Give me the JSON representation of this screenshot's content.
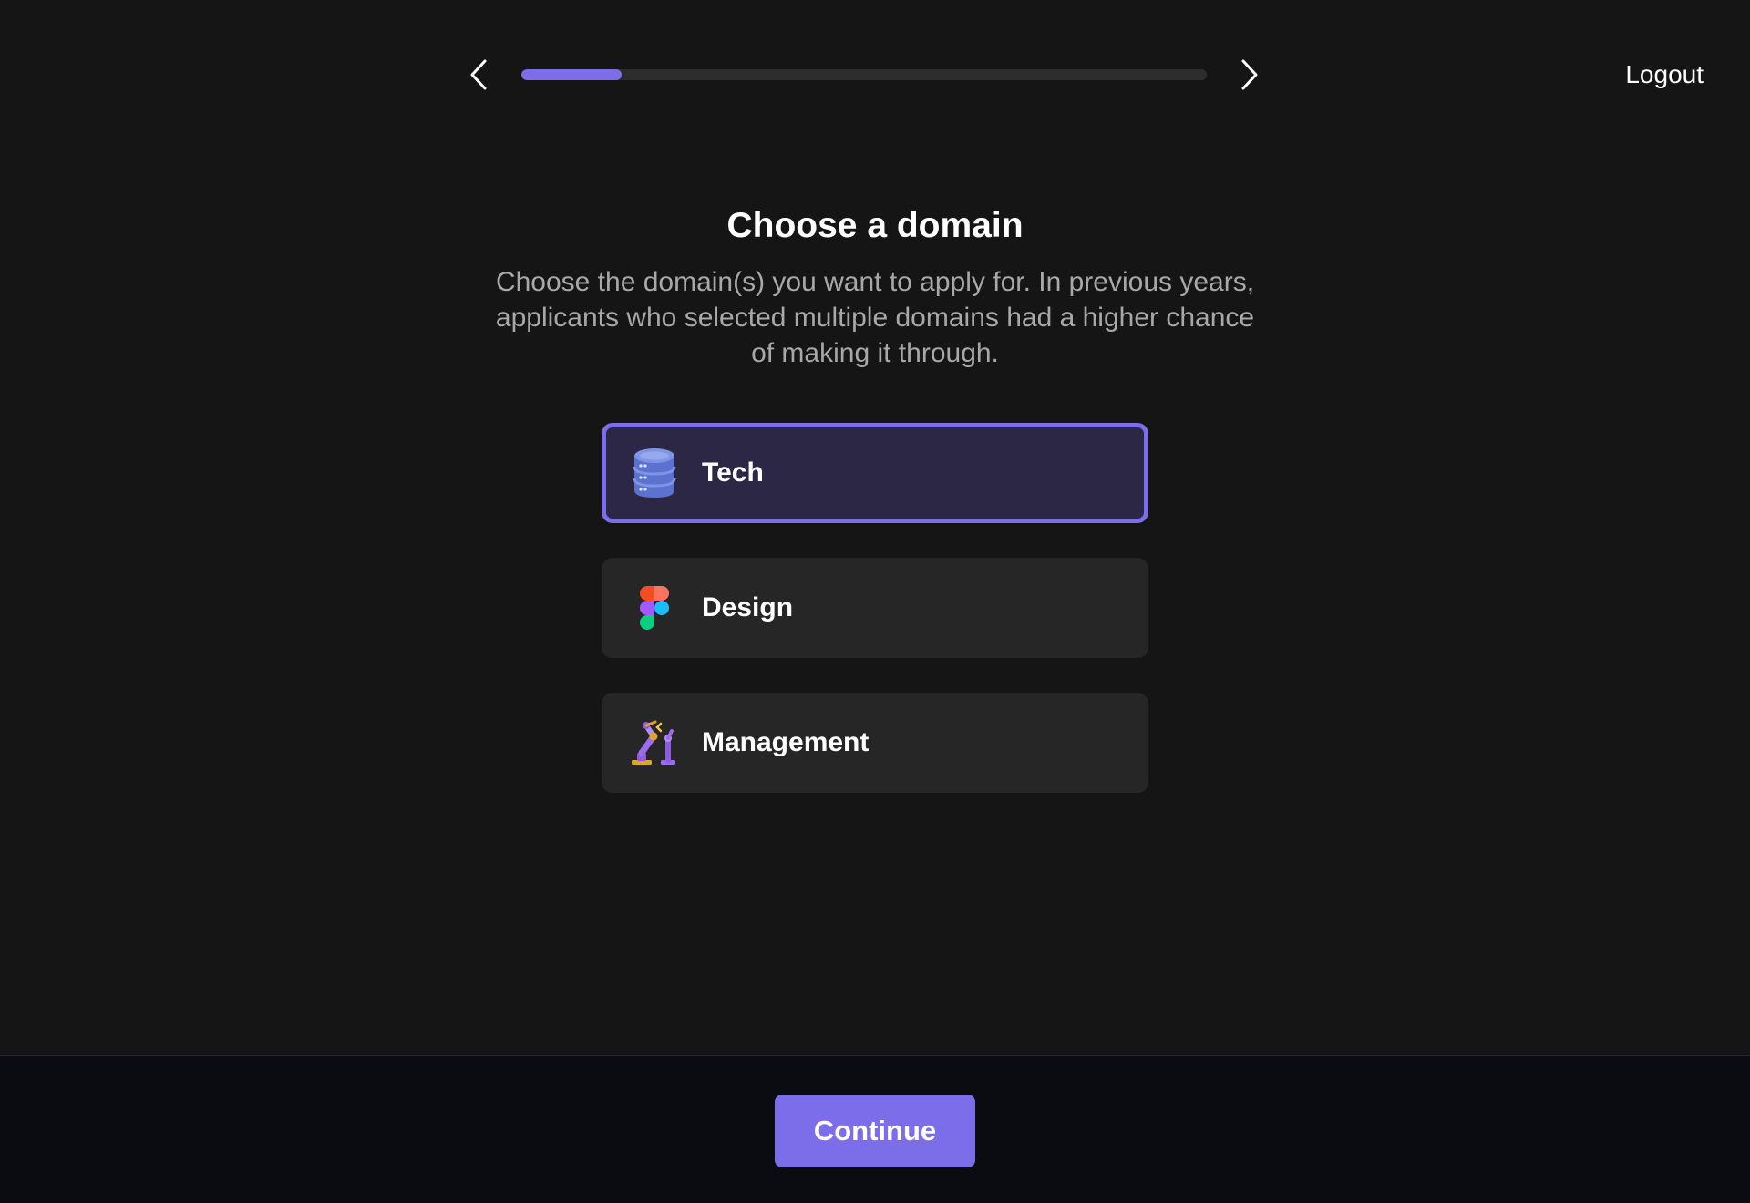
{
  "topbar": {
    "progress_percent": 14.6,
    "logout_label": "Logout",
    "back_icon": "chevron-left-icon",
    "forward_icon": "chevron-right-icon"
  },
  "header": {
    "title": "Choose a domain",
    "subtitle": "Choose the domain(s) you want to apply for. In previous years, applicants who selected multiple domains had a higher chance of making it through."
  },
  "options": [
    {
      "label": "Tech",
      "icon": "database-icon",
      "selected": true
    },
    {
      "label": "Design",
      "icon": "figma-icon",
      "selected": false
    },
    {
      "label": "Management",
      "icon": "robot-arm-icon",
      "selected": false
    }
  ],
  "footer": {
    "continue_label": "Continue"
  },
  "colors": {
    "accent": "#7b6ee8",
    "background": "#151515",
    "card": "#262626",
    "selected_card": "#2c2744",
    "footer_bg": "#0b0c12",
    "subtitle_text": "#a8a8a8"
  }
}
